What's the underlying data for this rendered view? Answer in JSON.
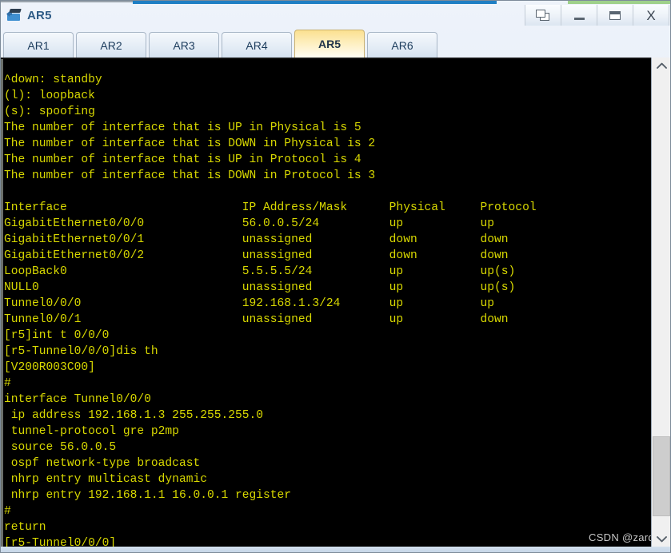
{
  "window": {
    "title": "AR5",
    "icon": "router-icon",
    "controls": [
      {
        "name": "restore-cascade-button",
        "icon": "cascade-windows-icon",
        "label": ""
      },
      {
        "name": "minimize-button",
        "icon": "minimize-icon",
        "label": ""
      },
      {
        "name": "maximize-button",
        "icon": "maximize-icon",
        "label": ""
      },
      {
        "name": "close-button",
        "icon": "close-icon",
        "label": "X"
      }
    ]
  },
  "tabs": [
    {
      "label": "AR1",
      "active": false
    },
    {
      "label": "AR2",
      "active": false
    },
    {
      "label": "AR3",
      "active": false
    },
    {
      "label": "AR4",
      "active": false
    },
    {
      "label": "AR5",
      "active": true
    },
    {
      "label": "AR6",
      "active": false
    }
  ],
  "terminal": {
    "foreground_color": "#d8d800",
    "background_color": "#000000",
    "legend": [
      "^down: standby",
      "(l): loopback",
      "(s): spoofing"
    ],
    "summary": [
      "The number of interface that is UP in Physical is 5",
      "The number of interface that is DOWN in Physical is 2",
      "The number of interface that is UP in Protocol is 4",
      "The number of interface that is DOWN in Protocol is 3"
    ],
    "interface_table": {
      "headers": [
        "Interface",
        "IP Address/Mask",
        "Physical",
        "Protocol"
      ],
      "rows": [
        [
          "GigabitEthernet0/0/0",
          "56.0.0.5/24",
          "up",
          "up"
        ],
        [
          "GigabitEthernet0/0/1",
          "unassigned",
          "down",
          "down"
        ],
        [
          "GigabitEthernet0/0/2",
          "unassigned",
          "down",
          "down"
        ],
        [
          "LoopBack0",
          "5.5.5.5/24",
          "up",
          "up(s)"
        ],
        [
          "NULL0",
          "unassigned",
          "up",
          "up(s)"
        ],
        [
          "Tunnel0/0/0",
          "192.168.1.3/24",
          "up",
          "up"
        ],
        [
          "Tunnel0/0/1",
          "unassigned",
          "up",
          "down"
        ]
      ]
    },
    "commands": [
      "[r5]int t 0/0/0",
      "[r5-Tunnel0/0/0]dis th",
      "[V200R003C00]",
      "#"
    ],
    "config": [
      "interface Tunnel0/0/0",
      " ip address 192.168.1.3 255.255.255.0",
      " tunnel-protocol gre p2mp",
      " source 56.0.0.5",
      " ospf network-type broadcast",
      " nhrp entry multicast dynamic",
      " nhrp entry 192.168.1.1 16.0.0.1 register",
      "#",
      "return"
    ],
    "prompt": "[r5-Tunnel0/0/0]",
    "full_text": "^down: standby\n(l): loopback\n(s): spoofing\nThe number of interface that is UP in Physical is 5\nThe number of interface that is DOWN in Physical is 2\nThe number of interface that is UP in Protocol is 4\nThe number of interface that is DOWN in Protocol is 3\n\nInterface                         IP Address/Mask      Physical     Protocol\nGigabitEthernet0/0/0              56.0.0.5/24          up           up\nGigabitEthernet0/0/1              unassigned           down         down\nGigabitEthernet0/0/2              unassigned           down         down\nLoopBack0                         5.5.5.5/24           up           up(s)\nNULL0                             unassigned           up           up(s)\nTunnel0/0/0                       192.168.1.3/24       up           up\nTunnel0/0/1                       unassigned           up           down\n[r5]int t 0/0/0\n[r5-Tunnel0/0/0]dis th\n[V200R003C00]\n#\ninterface Tunnel0/0/0\n ip address 192.168.1.3 255.255.255.0\n tunnel-protocol gre p2mp\n source 56.0.0.5\n ospf network-type broadcast\n nhrp entry multicast dynamic\n nhrp entry 192.168.1.1 16.0.0.1 register\n#\nreturn\n[r5-Tunnel0/0/0]"
  },
  "watermark": "CSDN @zard__",
  "scrollbar": {
    "up_arrow": "chevron-up-icon",
    "down_arrow": "chevron-down-icon"
  }
}
